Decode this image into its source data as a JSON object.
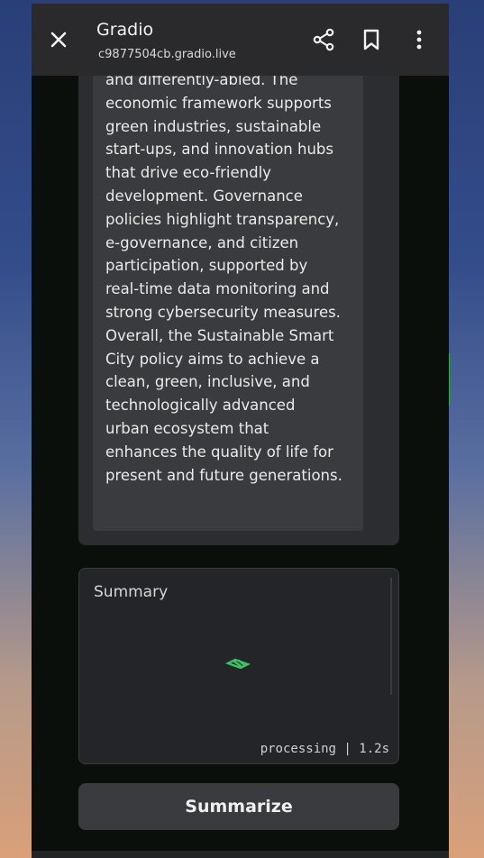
{
  "topbar": {
    "title": "Gradio",
    "url": "c9877504cb.gradio.live"
  },
  "icons": {
    "close": "close-icon",
    "share": "share-icon",
    "bookmark": "bookmark-icon",
    "more": "more-vertical-icon",
    "spinner": "loading-spinner-icon"
  },
  "document_text": "and differently-abled. The\neconomic framework supports\ngreen industries, sustainable\nstart-ups, and innovation hubs\nthat drive eco-friendly\ndevelopment. Governance\npolicies highlight transparency,\ne-governance, and citizen\nparticipation, supported by\nreal-time data monitoring and\nstrong cybersecurity measures.\nOverall, the Sustainable Smart\nCity policy aims to achieve a\nclean, green, inclusive, and\ntechnologically advanced\nurban ecosystem that\nenhances the quality of life for\npresent and future generations.",
  "summary": {
    "label": "Summary",
    "status": "processing | 1.2s"
  },
  "actions": {
    "summarize_label": "Summarize"
  },
  "colors": {
    "accent_green": "#2faa48",
    "panel": "#2c2d30",
    "topbar": "#2a2a2c"
  }
}
